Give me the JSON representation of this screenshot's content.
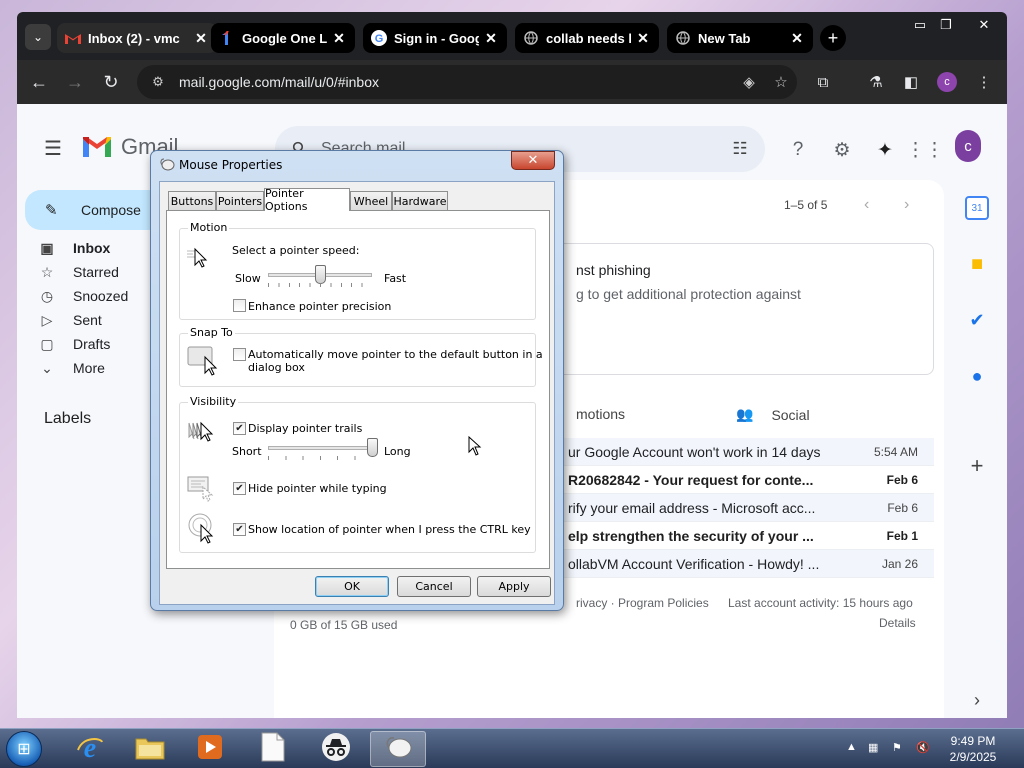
{
  "browser": {
    "tabs": [
      {
        "title": "Inbox (2) - vmc",
        "favicon": "gmail-icon",
        "active": true
      },
      {
        "title": "Google One La",
        "favicon": "google-one-icon"
      },
      {
        "title": "Sign in - Googl",
        "favicon": "google-g-icon"
      },
      {
        "title": "collab needs h",
        "favicon": "globe-icon"
      },
      {
        "title": "New Tab",
        "favicon": "globe-icon"
      }
    ],
    "url": "mail.google.com/mail/u/0/#inbox",
    "profile_initial": "c"
  },
  "gmail": {
    "app_name": "Gmail",
    "search_placeholder": "Search mail",
    "compose_label": "Compose",
    "avatar_initial": "c",
    "nav": [
      {
        "label": "Inbox",
        "icon": "inbox-icon",
        "active": true
      },
      {
        "label": "Starred",
        "icon": "star-icon"
      },
      {
        "label": "Snoozed",
        "icon": "clock-icon"
      },
      {
        "label": "Sent",
        "icon": "send-icon"
      },
      {
        "label": "Drafts",
        "icon": "draft-icon"
      },
      {
        "label": "More",
        "icon": "chevron-down-icon"
      }
    ],
    "labels_title": "Labels",
    "pager": "1–5 of 5",
    "phishing_title": "nst phishing",
    "phishing_sub": "g to get additional protection against",
    "categories": {
      "promotions": "motions",
      "social": "Social"
    },
    "emails": [
      {
        "subject": "ur Google Account won't work in 14 days",
        "date": "5:54 AM",
        "unread": false
      },
      {
        "subject": "R20682842 - Your request for conte...",
        "date": "Feb 6",
        "unread": true
      },
      {
        "subject": "rify your email address - Microsoft acc...",
        "date": "Feb 6",
        "unread": false
      },
      {
        "subject": "elp strengthen the security of your ...",
        "date": "Feb 1",
        "unread": true
      },
      {
        "subject": "ollabVM Account Verification - Howdy! ...",
        "date": "Jan 26",
        "unread": false
      }
    ],
    "footer_policies": "rivacy · Program Policies",
    "footer_activity": "Last account activity: 15 hours ago",
    "footer_details": "Details",
    "storage": "0 GB of 15 GB used"
  },
  "dialog": {
    "title": "Mouse Properties",
    "close": "✕",
    "tabs": [
      "Buttons",
      "Pointers",
      "Pointer Options",
      "Wheel",
      "Hardware"
    ],
    "active_tab": "Pointer Options",
    "motion": {
      "group": "Motion",
      "speed_label": "Select a pointer speed:",
      "slow": "Slow",
      "fast": "Fast",
      "speed_value": 0.5,
      "precision_label": "Enhance pointer precision",
      "precision_checked": false
    },
    "snap": {
      "group": "Snap To",
      "label_line1": "Automatically move pointer to the default button in a",
      "label_line2": "dialog box",
      "checked": false
    },
    "visibility": {
      "group": "Visibility",
      "trails_label": "Display pointer trails",
      "trails_checked": true,
      "short": "Short",
      "long": "Long",
      "trail_value": 1.0,
      "hide_label": "Hide pointer while typing",
      "hide_checked": true,
      "ctrl_label": "Show location of pointer when I press the CTRL key",
      "ctrl_checked": true
    },
    "buttons": {
      "ok": "OK",
      "cancel": "Cancel",
      "apply": "Apply"
    }
  },
  "taskbar": {
    "time": "9:49 PM",
    "date": "2/9/2025"
  }
}
